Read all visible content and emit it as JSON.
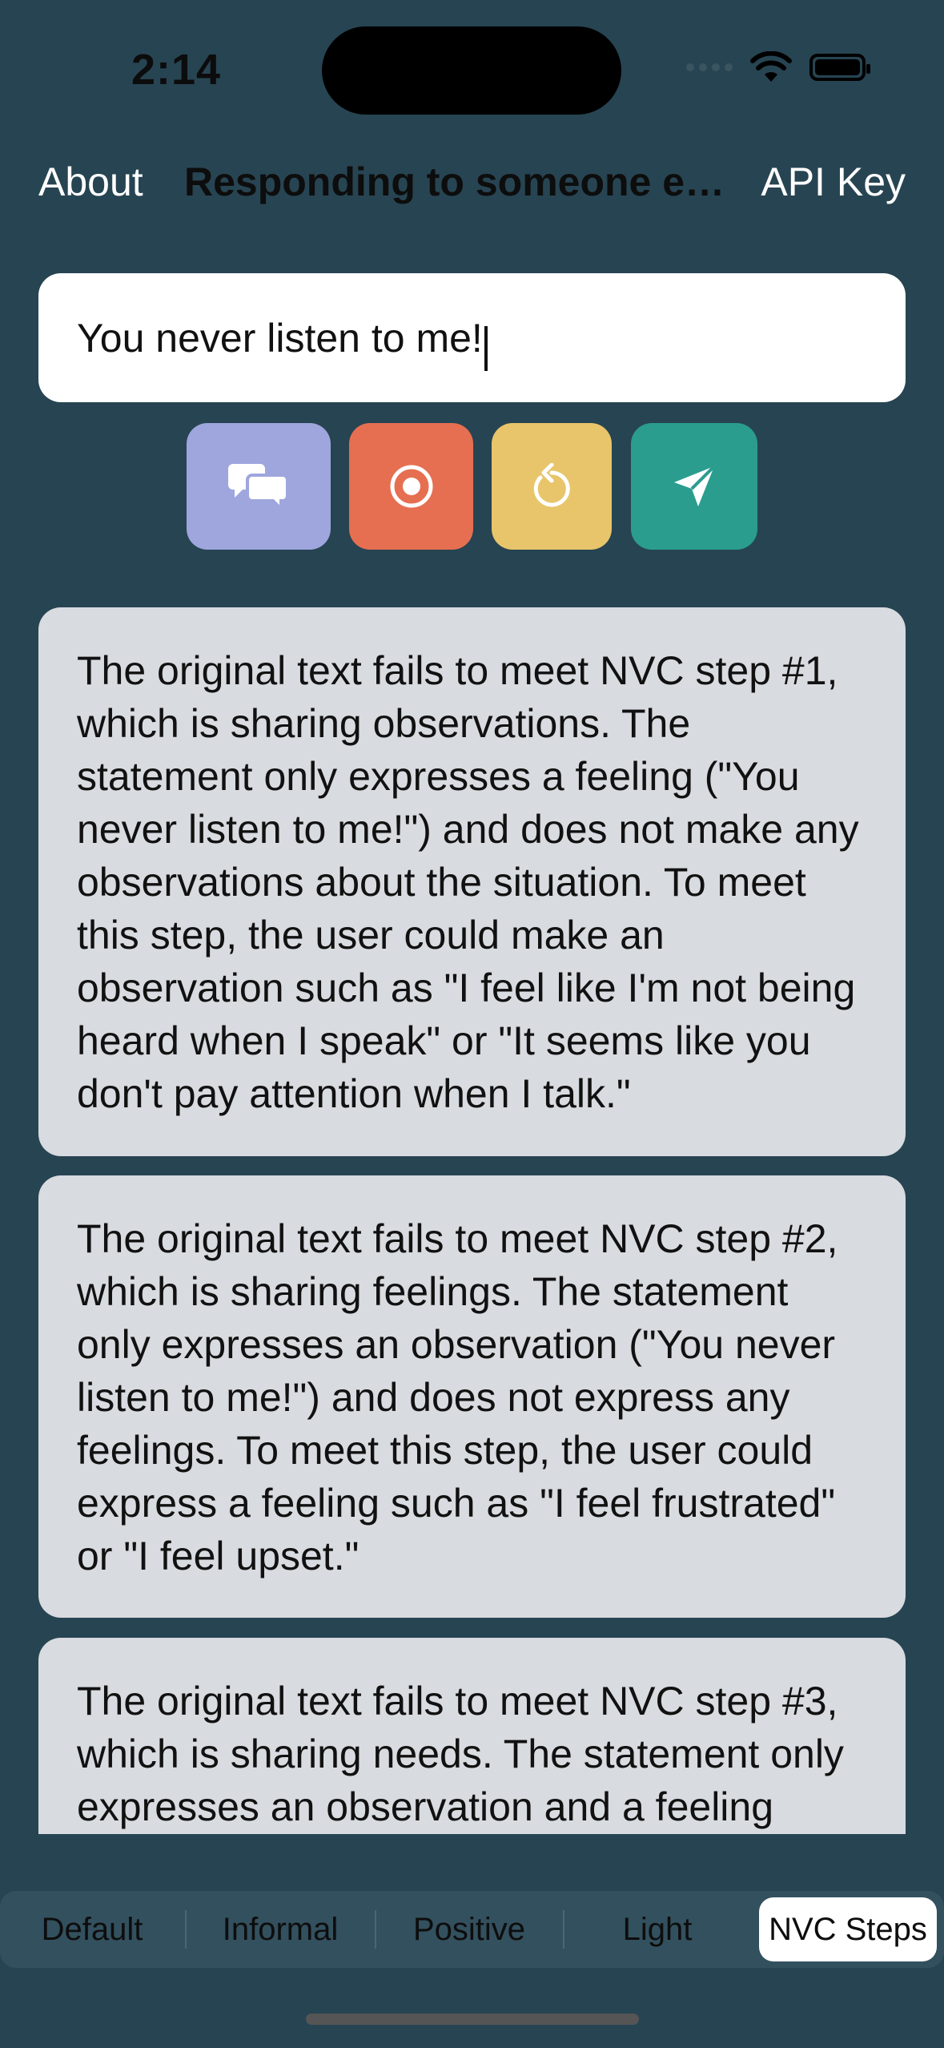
{
  "status_bar": {
    "time": "2:14"
  },
  "nav": {
    "left_button": "About",
    "title": "Responding to someone el...",
    "right_button": "API Key"
  },
  "input": {
    "value": "You never listen to me!"
  },
  "actions": {
    "chat_icon": "chat-bubbles-icon",
    "record_icon": "record-icon",
    "reset_icon": "reset-icon",
    "send_icon": "send-icon",
    "colors": {
      "chat": "#9ea6dd",
      "record": "#e66f51",
      "reset": "#e8c56b",
      "send": "#2a9d8f"
    }
  },
  "responses": [
    "The original text fails to meet NVC step #1, which is sharing observations. The statement only expresses a feeling (\"You never listen to me!\") and does not make any observations about the situation. To meet this step, the user could make an observation such as \"I feel like I'm not being heard when I speak\" or \"It seems like you don't pay attention when I talk.\"",
    "The original text fails to meet NVC step #2, which is sharing feelings. The statement only expresses an observation (\"You never listen to me!\") and does not express any feelings. To meet this step, the user could express a feeling such as \"I feel frustrated\" or \"I feel upset.\"",
    "The original text fails to meet NVC step #3, which is sharing needs. The statement only expresses an observation and a feeling"
  ],
  "tabs": [
    {
      "label": "Default"
    },
    {
      "label": "Informal"
    },
    {
      "label": "Positive"
    },
    {
      "label": "Light"
    },
    {
      "label": "NVC Steps"
    }
  ],
  "selected_tab": "NVC Steps"
}
